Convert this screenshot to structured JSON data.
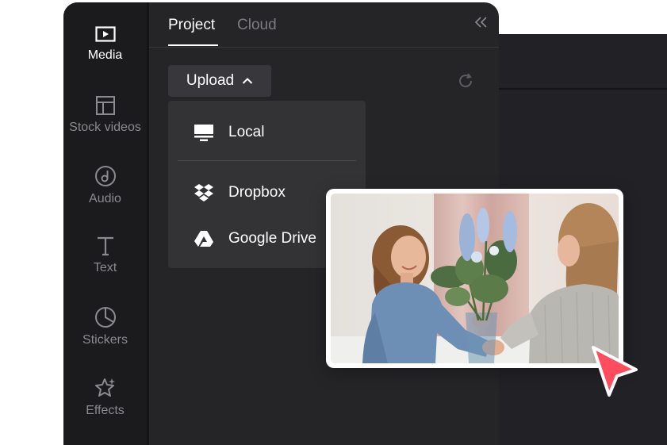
{
  "sidebar": {
    "items": [
      {
        "label": "Media",
        "icon": "media-icon",
        "active": true
      },
      {
        "label": "Stock videos",
        "icon": "stock-videos-icon",
        "active": false
      },
      {
        "label": "Audio",
        "icon": "audio-icon",
        "active": false
      },
      {
        "label": "Text",
        "icon": "text-icon",
        "active": false
      },
      {
        "label": "Stickers",
        "icon": "stickers-icon",
        "active": false
      },
      {
        "label": "Effects",
        "icon": "effects-icon",
        "active": false
      }
    ]
  },
  "tabs": {
    "project": "Project",
    "cloud": "Cloud",
    "active": "Project"
  },
  "upload": {
    "label": "Upload",
    "menu": [
      {
        "label": "Local",
        "icon": "monitor-icon"
      },
      {
        "label": "Dropbox",
        "icon": "dropbox-icon"
      },
      {
        "label": "Google Drive",
        "icon": "google-drive-icon"
      }
    ]
  },
  "colors": {
    "panel": "#252527",
    "sidebar": "#1b1b1d",
    "menu": "#333336",
    "cursor": "#ff4d5e"
  }
}
